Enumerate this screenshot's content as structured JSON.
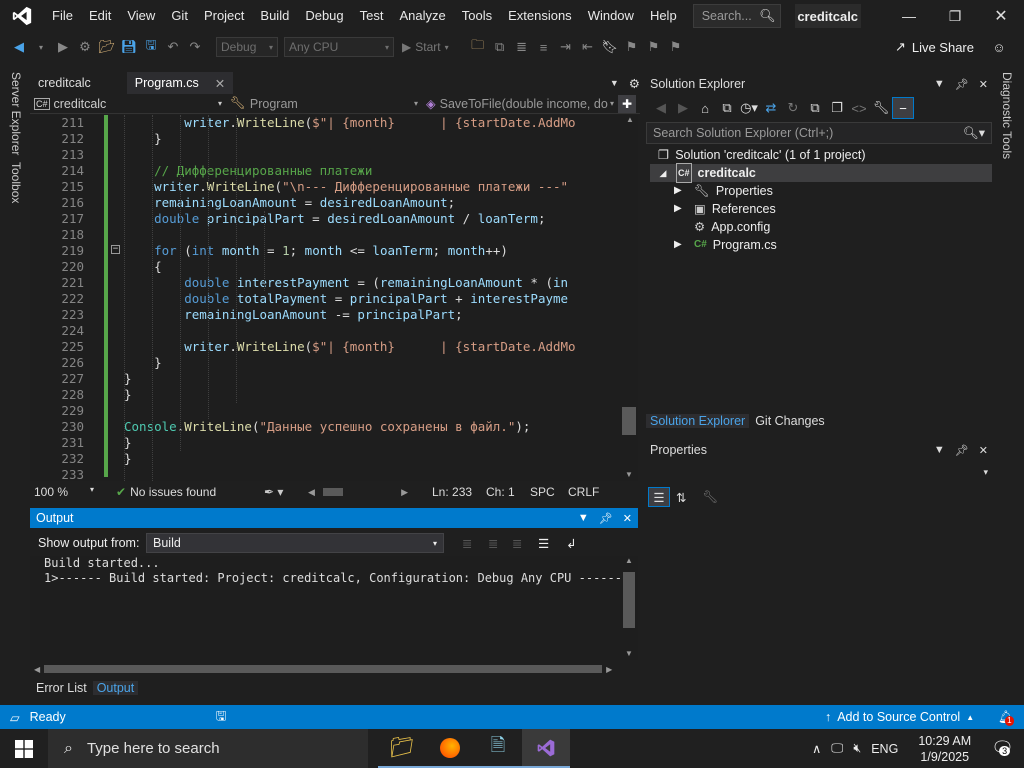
{
  "menubar": {
    "items": [
      "File",
      "Edit",
      "View",
      "Git",
      "Project",
      "Build",
      "Debug",
      "Test",
      "Analyze",
      "Tools",
      "Extensions",
      "Window",
      "Help"
    ],
    "search_placeholder": "Search...",
    "solution_name": "creditcalc"
  },
  "toolbar": {
    "config": "Debug",
    "platform": "Any CPU",
    "start": "Start",
    "live_share": "Live Share"
  },
  "side_tabs": {
    "left": [
      "Server Explorer",
      "Toolbox"
    ],
    "right": "Diagnostic Tools"
  },
  "editor": {
    "tabs": [
      "creditcalc",
      "Program.cs"
    ],
    "nav": {
      "project": "creditcalc",
      "class": "Program",
      "member": "SaveToFile(double income, do"
    },
    "lines": [
      {
        "n": "211",
        "html": "        <span class=\"vr\">writer</span>.<span class=\"mt\">WriteLine</span>(<span class=\"st\">$\"| {month}      | {startDate.AddMo</span>"
      },
      {
        "n": "212",
        "html": "    }"
      },
      {
        "n": "213",
        "html": ""
      },
      {
        "n": "214",
        "html": "    <span class=\"cm\">// Дифференцированные платежи</span>"
      },
      {
        "n": "215",
        "html": "    <span class=\"vr\">writer</span>.<span class=\"mt\">WriteLine</span>(<span class=\"st\">\"\\n--- Дифференцированные платежи ---\"</span>"
      },
      {
        "n": "216",
        "html": "    <span class=\"vr\">remainingLoanAmount</span> = <span class=\"vr\">desiredLoanAmount</span>;"
      },
      {
        "n": "217",
        "html": "    <span class=\"kw\">double</span> <span class=\"vr\">principalPart</span> = <span class=\"vr\">desiredLoanAmount</span> / <span class=\"vr\">loanTerm</span>;"
      },
      {
        "n": "218",
        "html": ""
      },
      {
        "n": "219",
        "html": "    <span class=\"kw\">for</span> (<span class=\"kw\">int</span> <span class=\"vr\">month</span> = <span class=\"nm\">1</span>; <span class=\"vr\">month</span> &lt;= <span class=\"vr\">loanTerm</span>; <span class=\"vr\">month</span>++)"
      },
      {
        "n": "220",
        "html": "    {"
      },
      {
        "n": "221",
        "html": "        <span class=\"kw\">double</span> <span class=\"vr\">interestPayment</span> = (<span class=\"vr\">remainingLoanAmount</span> * (<span class=\"vr\">in</span>"
      },
      {
        "n": "222",
        "html": "        <span class=\"kw\">double</span> <span class=\"vr\">totalPayment</span> = <span class=\"vr\">principalPart</span> + <span class=\"vr\">interestPayme</span>"
      },
      {
        "n": "223",
        "html": "        <span class=\"vr\">remainingLoanAmount</span> -= <span class=\"vr\">principalPart</span>;"
      },
      {
        "n": "224",
        "html": ""
      },
      {
        "n": "225",
        "html": "        <span class=\"vr\">writer</span>.<span class=\"mt\">WriteLine</span>(<span class=\"st\">$\"| {month}      | {startDate.AddMo</span>"
      },
      {
        "n": "226",
        "html": "    }"
      },
      {
        "n": "227",
        "html": "}"
      },
      {
        "n": "228",
        "html": "}"
      },
      {
        "n": "229",
        "html": ""
      },
      {
        "n": "230",
        "html": "<span class=\"ty\">Console</span>.<span class=\"mt\">WriteLine</span>(<span class=\"st\">\"Данные успешно сохранены в файл.\"</span>);"
      },
      {
        "n": "231",
        "html": "}"
      },
      {
        "n": "232",
        "html": "}"
      },
      {
        "n": "233",
        "html": ""
      }
    ],
    "status": {
      "zoom": "100 %",
      "issues": "No issues found",
      "ln": "Ln: 233",
      "ch": "Ch: 1",
      "spc": "SPC",
      "crlf": "CRLF"
    }
  },
  "output": {
    "title": "Output",
    "show_from_label": "Show output from:",
    "show_from_value": "Build",
    "lines": [
      "Build started...",
      "1>------ Build started: Project: creditcalc, Configuration: Debug Any CPU ------"
    ],
    "tabs": [
      "Error List",
      "Output"
    ]
  },
  "solution_explorer": {
    "title": "Solution Explorer",
    "search_placeholder": "Search Solution Explorer (Ctrl+;)",
    "solution": "Solution 'creditcalc' (1 of 1 project)",
    "project": "creditcalc",
    "items": [
      "Properties",
      "References",
      "App.config",
      "Program.cs"
    ],
    "tabs": [
      "Solution Explorer",
      "Git Changes"
    ]
  },
  "properties": {
    "title": "Properties"
  },
  "statusbar": {
    "ready": "Ready",
    "source_control": "Add to Source Control",
    "notif_count": "1"
  },
  "taskbar": {
    "search_placeholder": "Type here to search",
    "lang": "ENG",
    "time": "10:29 AM",
    "date": "1/9/2025",
    "notif": "3"
  },
  "colors": {
    "accent": "#007acc",
    "vs_purple": "#9b6bd6",
    "caret_green": "#57a64a"
  }
}
